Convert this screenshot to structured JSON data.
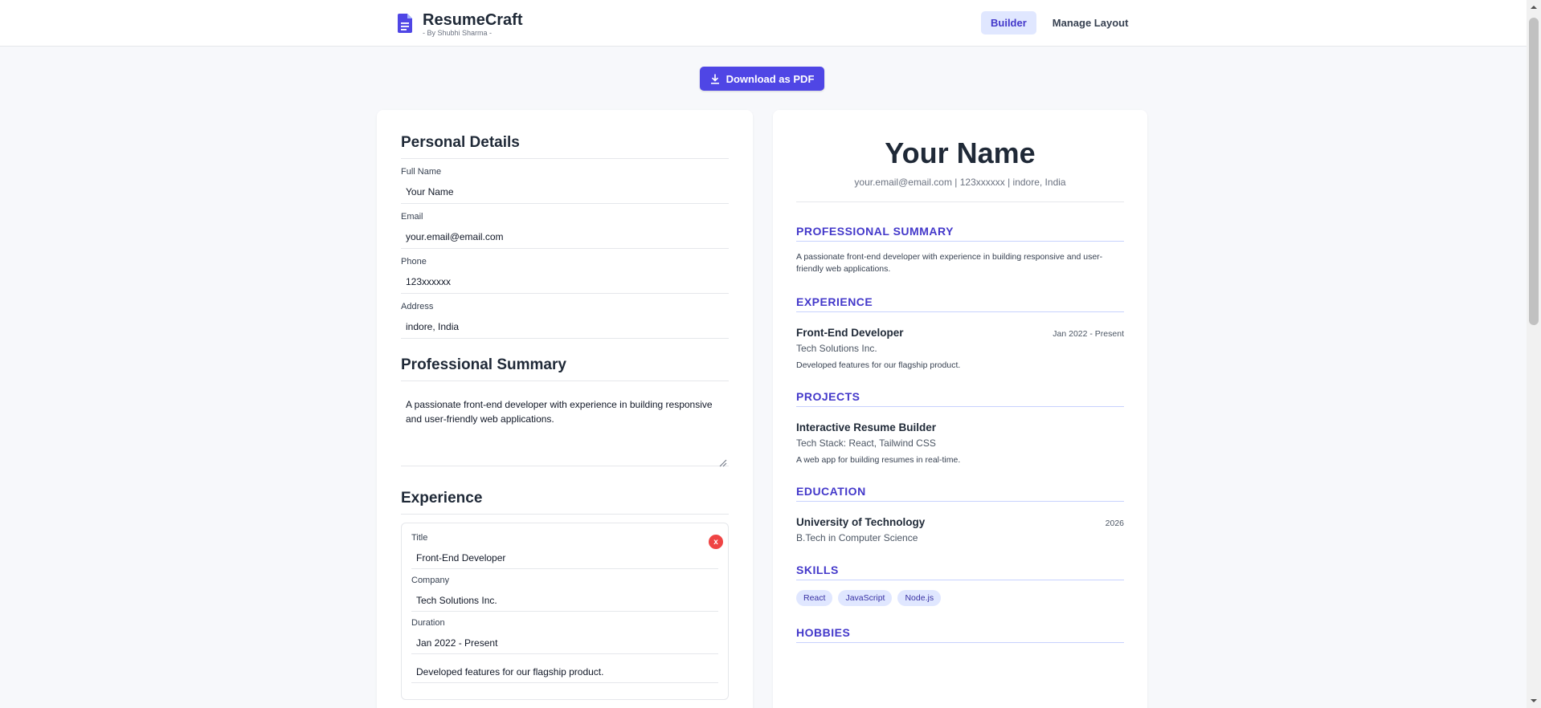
{
  "header": {
    "brand_title": "ResumeCraft",
    "brand_subtitle": "- By Shubhi Sharma -",
    "nav": [
      {
        "label": "Builder",
        "active": true
      },
      {
        "label": "Manage Layout",
        "active": false
      }
    ]
  },
  "toolbar": {
    "download_label": "Download as PDF"
  },
  "form": {
    "personal": {
      "heading": "Personal Details",
      "full_name_label": "Full Name",
      "full_name": "Your Name",
      "email_label": "Email",
      "email": "your.email@email.com",
      "phone_label": "Phone",
      "phone": "123xxxxxx",
      "address_label": "Address",
      "address": "indore, India"
    },
    "summary": {
      "heading": "Professional Summary",
      "text": "A passionate front-end developer with experience in building responsive and user-friendly web applications."
    },
    "experience": {
      "heading": "Experience",
      "remove_label": "x",
      "title_label": "Title",
      "title": "Front-End Developer",
      "company_label": "Company",
      "company": "Tech Solutions Inc.",
      "duration_label": "Duration",
      "duration": "Jan 2022 - Present",
      "description": "Developed features for our flagship product."
    }
  },
  "preview": {
    "name": "Your Name",
    "contact": "your.email@email.com | 123xxxxxx | indore, India",
    "summary_heading": "PROFESSIONAL SUMMARY",
    "summary": "A passionate front-end developer with experience in building responsive and user-friendly web applications.",
    "experience_heading": "EXPERIENCE",
    "experience": {
      "title": "Front-End Developer",
      "date": "Jan 2022 - Present",
      "company": "Tech Solutions Inc.",
      "description": "Developed features for our flagship product."
    },
    "projects_heading": "PROJECTS",
    "project": {
      "title": "Interactive Resume Builder",
      "stack": "Tech Stack: React, Tailwind CSS",
      "description": "A web app for building resumes in real-time."
    },
    "education_heading": "EDUCATION",
    "education": {
      "school": "University of Technology",
      "year": "2026",
      "degree": "B.Tech in Computer Science"
    },
    "skills_heading": "SKILLS",
    "skills": [
      "React",
      "JavaScript",
      "Node.js"
    ],
    "hobbies_heading": "HOBBIES"
  },
  "colors": {
    "accent": "#4f46e5",
    "heading_accent": "#4338ca",
    "danger": "#ef4444"
  }
}
